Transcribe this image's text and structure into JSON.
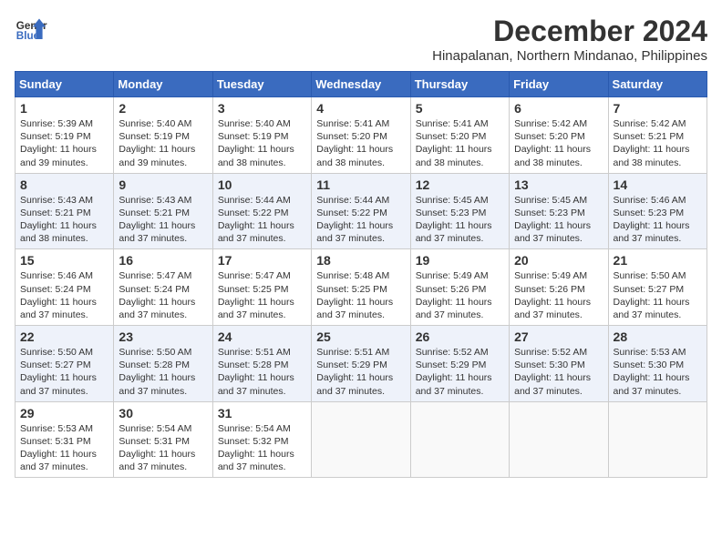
{
  "logo": {
    "line1": "General",
    "line2": "Blue"
  },
  "title": "December 2024",
  "location": "Hinapalanan, Northern Mindanao, Philippines",
  "days_of_week": [
    "Sunday",
    "Monday",
    "Tuesday",
    "Wednesday",
    "Thursday",
    "Friday",
    "Saturday"
  ],
  "weeks": [
    [
      {
        "day": "1",
        "info": "Sunrise: 5:39 AM\nSunset: 5:19 PM\nDaylight: 11 hours\nand 39 minutes."
      },
      {
        "day": "2",
        "info": "Sunrise: 5:40 AM\nSunset: 5:19 PM\nDaylight: 11 hours\nand 39 minutes."
      },
      {
        "day": "3",
        "info": "Sunrise: 5:40 AM\nSunset: 5:19 PM\nDaylight: 11 hours\nand 38 minutes."
      },
      {
        "day": "4",
        "info": "Sunrise: 5:41 AM\nSunset: 5:20 PM\nDaylight: 11 hours\nand 38 minutes."
      },
      {
        "day": "5",
        "info": "Sunrise: 5:41 AM\nSunset: 5:20 PM\nDaylight: 11 hours\nand 38 minutes."
      },
      {
        "day": "6",
        "info": "Sunrise: 5:42 AM\nSunset: 5:20 PM\nDaylight: 11 hours\nand 38 minutes."
      },
      {
        "day": "7",
        "info": "Sunrise: 5:42 AM\nSunset: 5:21 PM\nDaylight: 11 hours\nand 38 minutes."
      }
    ],
    [
      {
        "day": "8",
        "info": "Sunrise: 5:43 AM\nSunset: 5:21 PM\nDaylight: 11 hours\nand 38 minutes."
      },
      {
        "day": "9",
        "info": "Sunrise: 5:43 AM\nSunset: 5:21 PM\nDaylight: 11 hours\nand 37 minutes."
      },
      {
        "day": "10",
        "info": "Sunrise: 5:44 AM\nSunset: 5:22 PM\nDaylight: 11 hours\nand 37 minutes."
      },
      {
        "day": "11",
        "info": "Sunrise: 5:44 AM\nSunset: 5:22 PM\nDaylight: 11 hours\nand 37 minutes."
      },
      {
        "day": "12",
        "info": "Sunrise: 5:45 AM\nSunset: 5:23 PM\nDaylight: 11 hours\nand 37 minutes."
      },
      {
        "day": "13",
        "info": "Sunrise: 5:45 AM\nSunset: 5:23 PM\nDaylight: 11 hours\nand 37 minutes."
      },
      {
        "day": "14",
        "info": "Sunrise: 5:46 AM\nSunset: 5:23 PM\nDaylight: 11 hours\nand 37 minutes."
      }
    ],
    [
      {
        "day": "15",
        "info": "Sunrise: 5:46 AM\nSunset: 5:24 PM\nDaylight: 11 hours\nand 37 minutes."
      },
      {
        "day": "16",
        "info": "Sunrise: 5:47 AM\nSunset: 5:24 PM\nDaylight: 11 hours\nand 37 minutes."
      },
      {
        "day": "17",
        "info": "Sunrise: 5:47 AM\nSunset: 5:25 PM\nDaylight: 11 hours\nand 37 minutes."
      },
      {
        "day": "18",
        "info": "Sunrise: 5:48 AM\nSunset: 5:25 PM\nDaylight: 11 hours\nand 37 minutes."
      },
      {
        "day": "19",
        "info": "Sunrise: 5:49 AM\nSunset: 5:26 PM\nDaylight: 11 hours\nand 37 minutes."
      },
      {
        "day": "20",
        "info": "Sunrise: 5:49 AM\nSunset: 5:26 PM\nDaylight: 11 hours\nand 37 minutes."
      },
      {
        "day": "21",
        "info": "Sunrise: 5:50 AM\nSunset: 5:27 PM\nDaylight: 11 hours\nand 37 minutes."
      }
    ],
    [
      {
        "day": "22",
        "info": "Sunrise: 5:50 AM\nSunset: 5:27 PM\nDaylight: 11 hours\nand 37 minutes."
      },
      {
        "day": "23",
        "info": "Sunrise: 5:50 AM\nSunset: 5:28 PM\nDaylight: 11 hours\nand 37 minutes."
      },
      {
        "day": "24",
        "info": "Sunrise: 5:51 AM\nSunset: 5:28 PM\nDaylight: 11 hours\nand 37 minutes."
      },
      {
        "day": "25",
        "info": "Sunrise: 5:51 AM\nSunset: 5:29 PM\nDaylight: 11 hours\nand 37 minutes."
      },
      {
        "day": "26",
        "info": "Sunrise: 5:52 AM\nSunset: 5:29 PM\nDaylight: 11 hours\nand 37 minutes."
      },
      {
        "day": "27",
        "info": "Sunrise: 5:52 AM\nSunset: 5:30 PM\nDaylight: 11 hours\nand 37 minutes."
      },
      {
        "day": "28",
        "info": "Sunrise: 5:53 AM\nSunset: 5:30 PM\nDaylight: 11 hours\nand 37 minutes."
      }
    ],
    [
      {
        "day": "29",
        "info": "Sunrise: 5:53 AM\nSunset: 5:31 PM\nDaylight: 11 hours\nand 37 minutes."
      },
      {
        "day": "30",
        "info": "Sunrise: 5:54 AM\nSunset: 5:31 PM\nDaylight: 11 hours\nand 37 minutes."
      },
      {
        "day": "31",
        "info": "Sunrise: 5:54 AM\nSunset: 5:32 PM\nDaylight: 11 hours\nand 37 minutes."
      },
      {
        "day": "",
        "info": ""
      },
      {
        "day": "",
        "info": ""
      },
      {
        "day": "",
        "info": ""
      },
      {
        "day": "",
        "info": ""
      }
    ]
  ]
}
